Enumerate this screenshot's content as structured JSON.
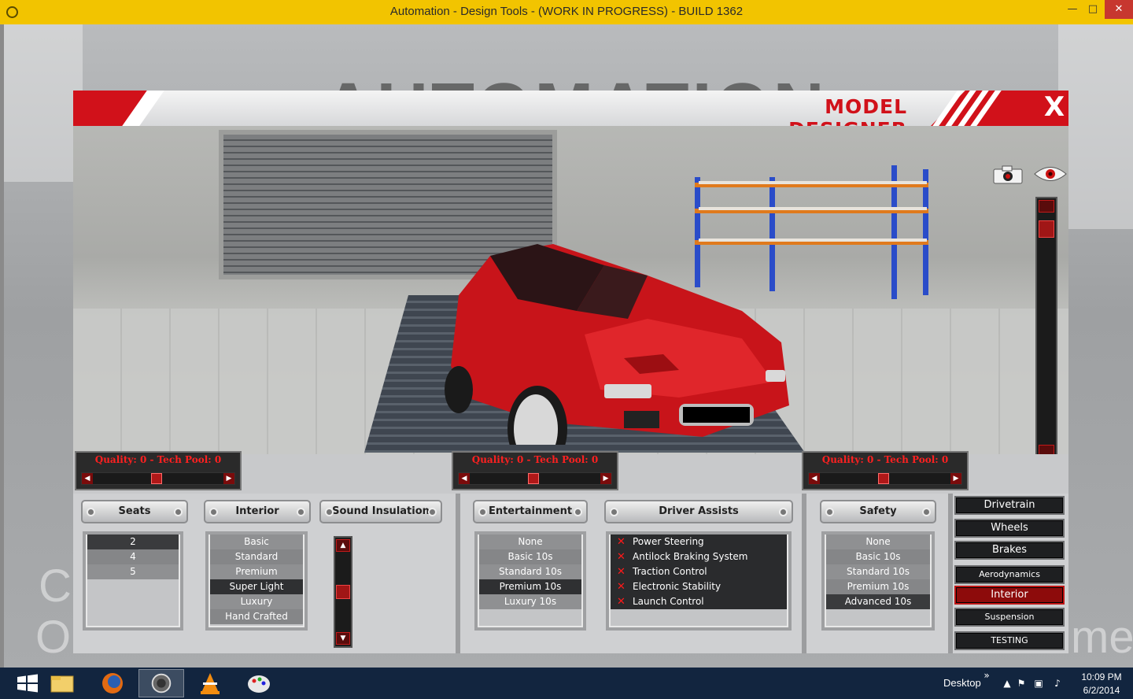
{
  "window": {
    "title": "Automation - Design Tools - (WORK IN PROGRESS) - BUILD 1362",
    "min_label": "—",
    "max_label": "□",
    "close_label": "✕"
  },
  "background": {
    "logo_text": "AUTOMATION",
    "glyph_c": "C",
    "glyph_o": "O",
    "glyph_me": "me"
  },
  "panel": {
    "title": "MODEL DESIGNER",
    "close_label": "X"
  },
  "quality_bars": [
    {
      "label": "Quality: 0 - Tech Pool: 0"
    },
    {
      "label": "Quality: 0 - Tech Pool: 0"
    },
    {
      "label": "Quality: 0 - Tech Pool: 0"
    }
  ],
  "categories": {
    "seats": "Seats",
    "interior": "Interior",
    "sound_insulation": "Sound Insulation",
    "entertainment": "Entertainment",
    "driver_assists": "Driver Assists",
    "safety": "Safety"
  },
  "lists": {
    "seats": [
      "2",
      "4",
      "5"
    ],
    "interior": [
      "Basic",
      "Standard",
      "Premium",
      "Super Light",
      "Luxury",
      "Hand Crafted"
    ],
    "entertainment": [
      "None",
      "Basic 10s",
      "Standard 10s",
      "Premium 10s",
      "Luxury 10s"
    ],
    "driver_assists": [
      "Power Steering",
      "Antilock Braking System",
      "Traction Control",
      "Electronic Stability",
      "Launch Control"
    ],
    "safety": [
      "None",
      "Basic 10s",
      "Standard 10s",
      "Premium 10s",
      "Advanced 10s"
    ]
  },
  "nav": {
    "drivetrain": "Drivetrain",
    "wheels": "Wheels",
    "brakes": "Brakes",
    "aerodynamics": "Aerodynamics",
    "interior": "Interior",
    "suspension": "Suspension",
    "testing": "TESTING",
    "active": "Interior"
  },
  "taskbar": {
    "desktop_label": "Desktop",
    "chevron": "»",
    "time": "10:09 PM",
    "date": "6/2/2014"
  },
  "colors": {
    "accent_red": "#d1111a",
    "title_bar": "#f2c400",
    "taskbar": "#12253f"
  }
}
